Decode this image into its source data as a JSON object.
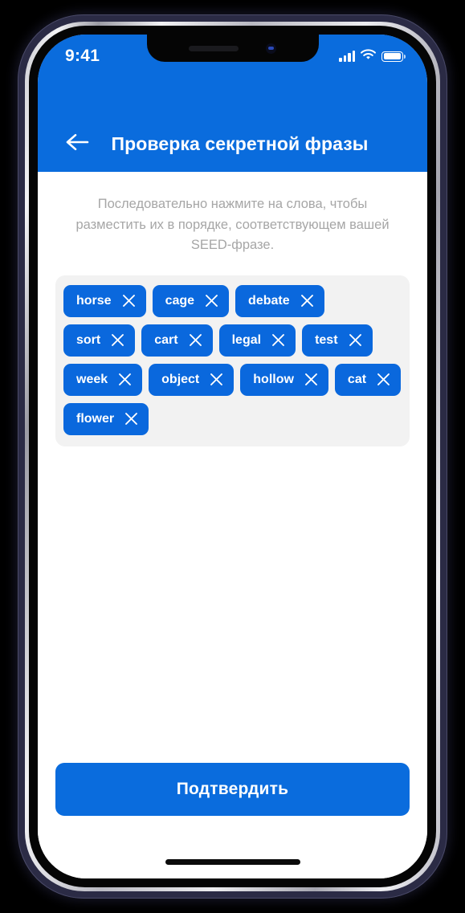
{
  "status_bar": {
    "time": "9:41",
    "signal_icon": "signal-bars-icon",
    "wifi_icon": "wifi-icon",
    "battery_icon": "battery-full-icon"
  },
  "app_bar": {
    "back_icon": "arrow-left-icon",
    "title": "Проверка секретной фразы"
  },
  "content": {
    "instruction": "Последовательно нажмите на слова, чтобы разместить их в порядке,  соответствующем вашей SEED-фразе.",
    "remove_icon": "close-x-icon",
    "words": [
      {
        "label": "horse"
      },
      {
        "label": "cage"
      },
      {
        "label": "debate"
      },
      {
        "label": "sort"
      },
      {
        "label": "cart"
      },
      {
        "label": "legal"
      },
      {
        "label": "test"
      },
      {
        "label": "week"
      },
      {
        "label": "object"
      },
      {
        "label": "hollow"
      },
      {
        "label": "cat"
      },
      {
        "label": "flower"
      }
    ]
  },
  "footer": {
    "confirm_label": "Подтвердить"
  },
  "colors": {
    "brand_blue": "#0a6cdd",
    "chip_blue": "#0a68dd",
    "chip_box_bg": "#f2f2f2",
    "instruction_text": "#a6a6a6",
    "screen_bg": "#ffffff"
  }
}
